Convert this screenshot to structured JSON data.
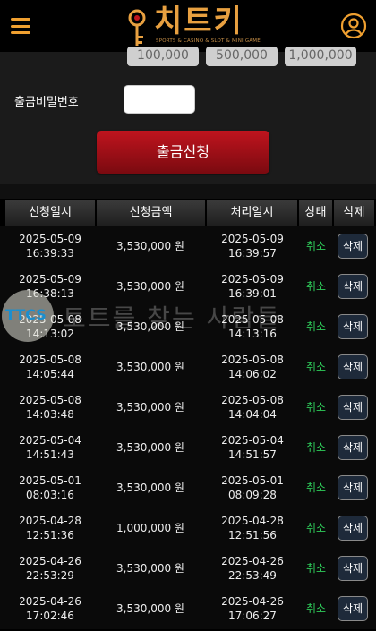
{
  "header": {
    "logo_text": "치트키",
    "logo_subtitle": "SPORTS & CASINO & SLOT & MINI GAME"
  },
  "amount_buttons": [
    "100,000",
    "500,000",
    "1,000,000"
  ],
  "form": {
    "password_label": "출금비밀번호",
    "password_value": "",
    "submit_label": "출금신청"
  },
  "table": {
    "headers": [
      "신청일시",
      "신청금액",
      "처리일시",
      "상태",
      "삭제"
    ],
    "rows": [
      {
        "req_date": "2025-05-09",
        "req_time": "16:39:33",
        "amount": "3,530,000 원",
        "proc_date": "2025-05-09",
        "proc_time": "16:39:57",
        "status": "취소",
        "delete": "삭제"
      },
      {
        "req_date": "2025-05-09",
        "req_time": "16:38:13",
        "amount": "3,530,000 원",
        "proc_date": "2025-05-09",
        "proc_time": "16:39:01",
        "status": "취소",
        "delete": "삭제"
      },
      {
        "req_date": "2025-05-08",
        "req_time": "14:13:02",
        "amount": "3,530,000 원",
        "proc_date": "2025-05-08",
        "proc_time": "14:13:16",
        "status": "취소",
        "delete": "삭제"
      },
      {
        "req_date": "2025-05-08",
        "req_time": "14:05:44",
        "amount": "3,530,000 원",
        "proc_date": "2025-05-08",
        "proc_time": "14:06:02",
        "status": "취소",
        "delete": "삭제"
      },
      {
        "req_date": "2025-05-08",
        "req_time": "14:03:48",
        "amount": "3,530,000 원",
        "proc_date": "2025-05-08",
        "proc_time": "14:04:04",
        "status": "취소",
        "delete": "삭제"
      },
      {
        "req_date": "2025-05-04",
        "req_time": "14:51:43",
        "amount": "3,530,000 원",
        "proc_date": "2025-05-04",
        "proc_time": "14:51:57",
        "status": "취소",
        "delete": "삭제"
      },
      {
        "req_date": "2025-05-01",
        "req_time": "08:03:16",
        "amount": "3,530,000 원",
        "proc_date": "2025-05-01",
        "proc_time": "08:09:28",
        "status": "취소",
        "delete": "삭제"
      },
      {
        "req_date": "2025-04-28",
        "req_time": "12:51:36",
        "amount": "1,000,000 원",
        "proc_date": "2025-04-28",
        "proc_time": "12:51:56",
        "status": "취소",
        "delete": "삭제"
      },
      {
        "req_date": "2025-04-26",
        "req_time": "22:53:29",
        "amount": "3,530,000 원",
        "proc_date": "2025-04-26",
        "proc_time": "22:53:49",
        "status": "취소",
        "delete": "삭제"
      },
      {
        "req_date": "2025-04-26",
        "req_time": "17:02:46",
        "amount": "3,530,000 원",
        "proc_date": "2025-04-26",
        "proc_time": "17:06:27",
        "status": "취소",
        "delete": "삭제"
      }
    ]
  },
  "watermark": {
    "badge": "TTCS",
    "text": "토트를 찾는 사람들"
  },
  "colors": {
    "accent": "#e8a040",
    "submit": "#b0111a",
    "status_cancel": "#2ecc5a"
  }
}
